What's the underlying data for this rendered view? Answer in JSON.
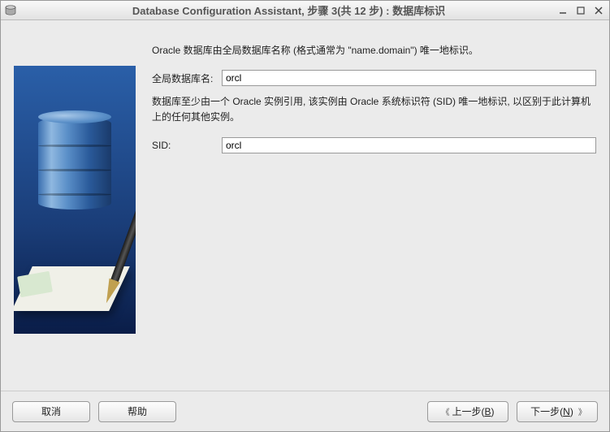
{
  "window": {
    "title": "Database Configuration Assistant, 步骤 3(共 12 步) : 数据库标识"
  },
  "content": {
    "intro": "Oracle 数据库由全局数据库名称 (格式通常为 \"name.domain\") 唯一地标识。",
    "global_db_label": "全局数据库名:",
    "global_db_value": "orcl",
    "sid_intro": "数据库至少由一个 Oracle 实例引用, 该实例由 Oracle 系统标识符 (SID) 唯一地标识, 以区别于此计算机上的任何其他实例。",
    "sid_label": "SID:",
    "sid_value": "orcl"
  },
  "buttons": {
    "cancel": "取消",
    "help": "帮助",
    "back_prefix": "上一步(",
    "back_key": "B",
    "back_suffix": ")",
    "next_prefix": "下一步(",
    "next_key": "N",
    "next_suffix": ")"
  }
}
